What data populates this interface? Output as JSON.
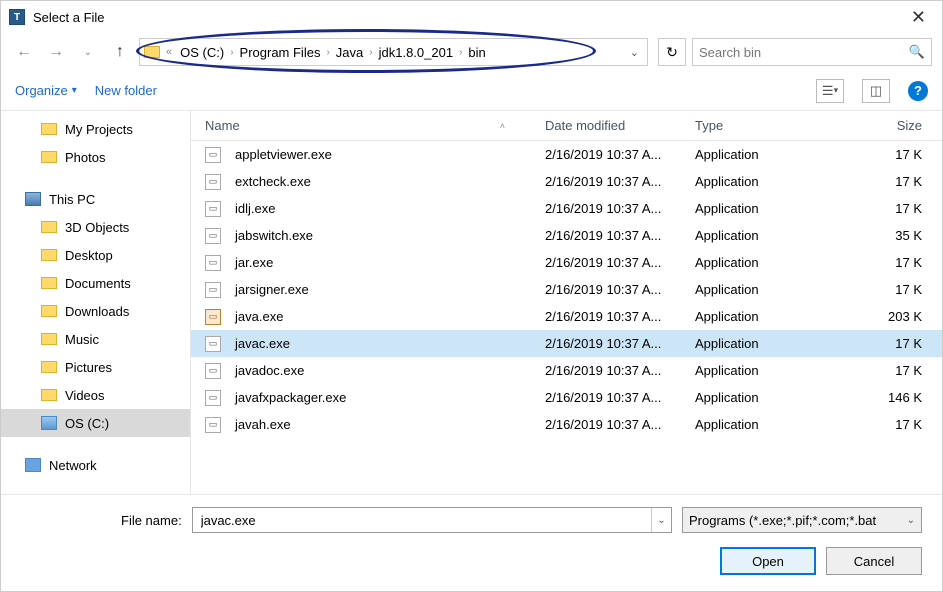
{
  "window": {
    "title": "Select a File"
  },
  "nav": {
    "refresh_glyph": "↻"
  },
  "breadcrumbs": {
    "items": [
      "OS (C:)",
      "Program Files",
      "Java",
      "jdk1.8.0_201",
      "bin"
    ]
  },
  "search": {
    "placeholder": "Search bin"
  },
  "toolbar": {
    "organize": "Organize",
    "new_folder": "New folder"
  },
  "sidebar": {
    "quick": [
      {
        "label": "My Projects",
        "icon": "folder"
      },
      {
        "label": "Photos",
        "icon": "folder"
      }
    ],
    "this_pc": "This PC",
    "pc_items": [
      {
        "label": "3D Objects",
        "icon": "folder"
      },
      {
        "label": "Desktop",
        "icon": "folder"
      },
      {
        "label": "Documents",
        "icon": "folder"
      },
      {
        "label": "Downloads",
        "icon": "folder"
      },
      {
        "label": "Music",
        "icon": "folder"
      },
      {
        "label": "Pictures",
        "icon": "folder"
      },
      {
        "label": "Videos",
        "icon": "folder"
      },
      {
        "label": "OS (C:)",
        "icon": "drive",
        "selected": true
      }
    ],
    "network": "Network"
  },
  "columns": {
    "name": "Name",
    "date": "Date modified",
    "type": "Type",
    "size": "Size"
  },
  "files": [
    {
      "name": "appletviewer.exe",
      "date": "2/16/2019 10:37 A...",
      "type": "Application",
      "size": "17 K",
      "icon": "exe"
    },
    {
      "name": "extcheck.exe",
      "date": "2/16/2019 10:37 A...",
      "type": "Application",
      "size": "17 K",
      "icon": "exe"
    },
    {
      "name": "idlj.exe",
      "date": "2/16/2019 10:37 A...",
      "type": "Application",
      "size": "17 K",
      "icon": "exe"
    },
    {
      "name": "jabswitch.exe",
      "date": "2/16/2019 10:37 A...",
      "type": "Application",
      "size": "35 K",
      "icon": "exe"
    },
    {
      "name": "jar.exe",
      "date": "2/16/2019 10:37 A...",
      "type": "Application",
      "size": "17 K",
      "icon": "exe"
    },
    {
      "name": "jarsigner.exe",
      "date": "2/16/2019 10:37 A...",
      "type": "Application",
      "size": "17 K",
      "icon": "exe"
    },
    {
      "name": "java.exe",
      "date": "2/16/2019 10:37 A...",
      "type": "Application",
      "size": "203 K",
      "icon": "java"
    },
    {
      "name": "javac.exe",
      "date": "2/16/2019 10:37 A...",
      "type": "Application",
      "size": "17 K",
      "icon": "exe",
      "selected": true
    },
    {
      "name": "javadoc.exe",
      "date": "2/16/2019 10:37 A...",
      "type": "Application",
      "size": "17 K",
      "icon": "exe"
    },
    {
      "name": "javafxpackager.exe",
      "date": "2/16/2019 10:37 A...",
      "type": "Application",
      "size": "146 K",
      "icon": "exe"
    },
    {
      "name": "javah.exe",
      "date": "2/16/2019 10:37 A...",
      "type": "Application",
      "size": "17 K",
      "icon": "exe"
    }
  ],
  "footer": {
    "filename_label": "File name:",
    "filename_value": "javac.exe",
    "filter": "Programs (*.exe;*.pif;*.com;*.bat",
    "open": "Open",
    "cancel": "Cancel"
  }
}
